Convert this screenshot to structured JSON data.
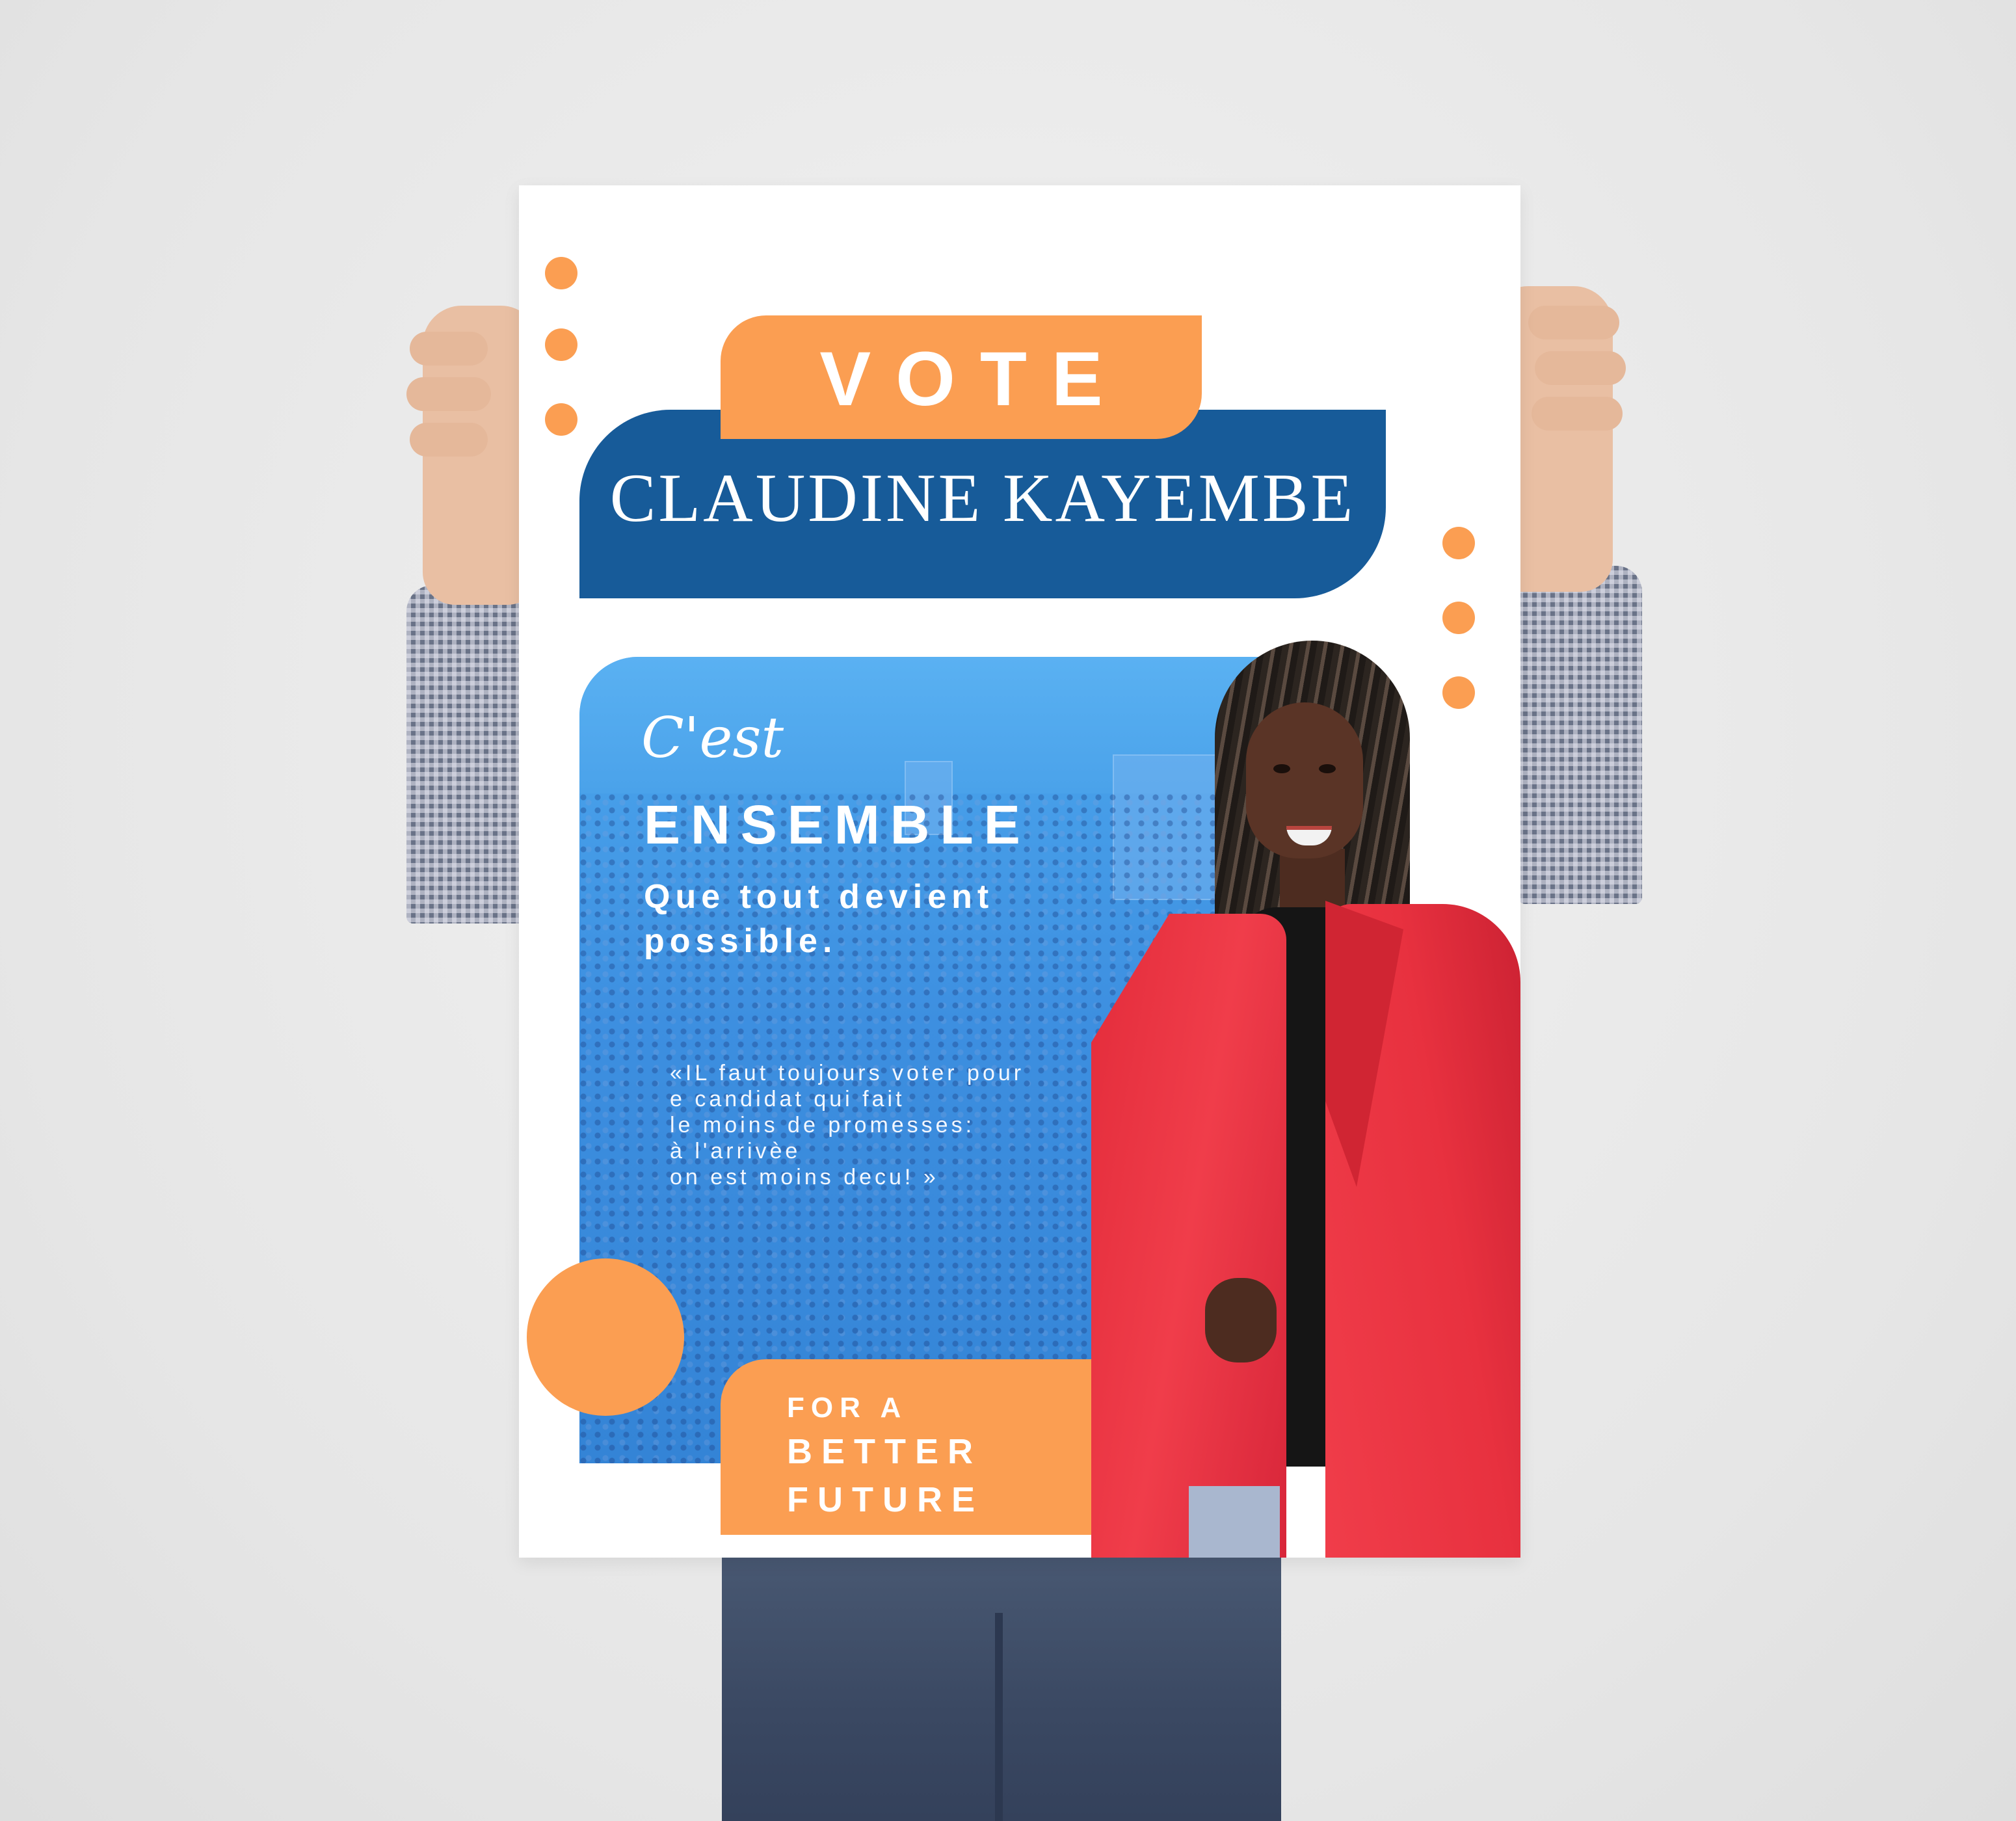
{
  "poster": {
    "vote": "VOTE",
    "candidate_name": "CLAUDINE KAYEMBE",
    "cest": "C'est",
    "ensemble": "ENSEMBLE",
    "slogan": "Que tout devient possible.",
    "quote": "«IL faut toujours voter pour\ne candidat qui fait\nle moins de promesses:\nà l'arrivèe\non est moins decu! »",
    "for_a": "FOR A",
    "better_future": "BETTER\nFUTURE"
  },
  "colors": {
    "orange": "#fb9e52",
    "navy": "#175b99",
    "sky_blue": "#3d8fe0",
    "jacket_red": "#e8313f",
    "white": "#ffffff"
  }
}
